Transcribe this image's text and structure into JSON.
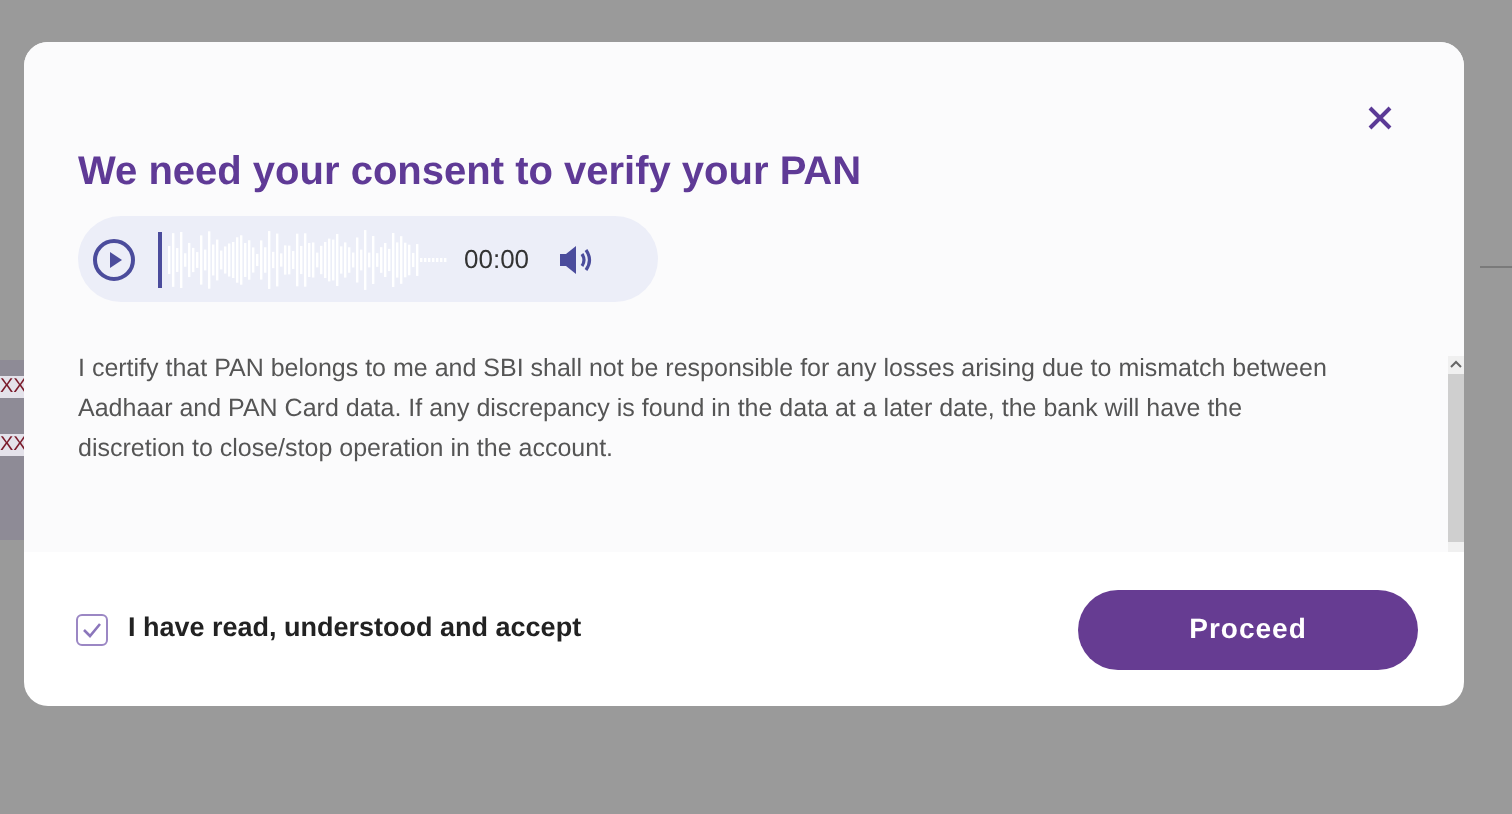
{
  "background": {
    "marks": [
      "XX",
      "XX"
    ]
  },
  "dialog": {
    "title": "We need your consent to verify your PAN",
    "audio": {
      "time": "00:00"
    },
    "body": "I certify that PAN belongs to me and SBI shall not be responsible for any losses arising due to mismatch between Aadhaar and PAN Card data. If any discrepancy is found in the data at a later date, the bank will have the discretion to close/stop operation in the account.",
    "consent": {
      "label": "I have read, understood and accept",
      "checked": true
    },
    "button": "Proceed"
  }
}
